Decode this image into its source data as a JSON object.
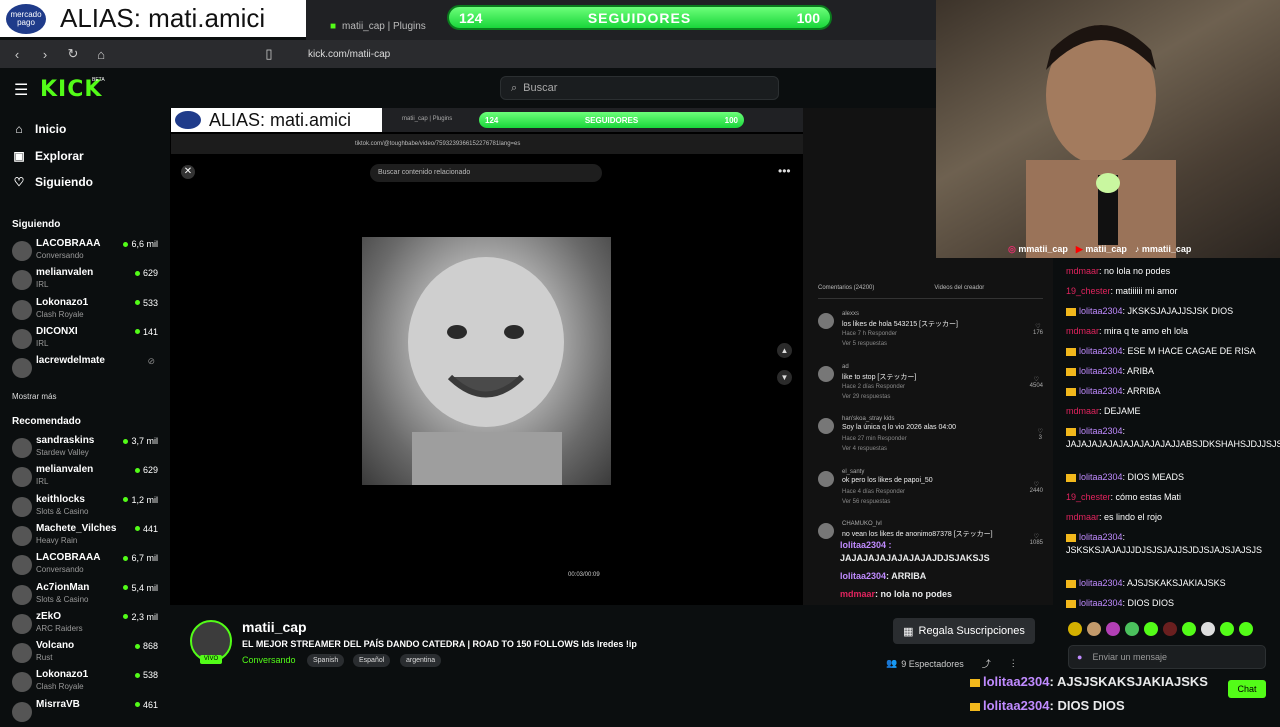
{
  "overlay": {
    "mp_logo": "mercado pago",
    "alias": "ALIAS: mati.amici",
    "followers_current": "124",
    "followers_label": "SEGUIDORES",
    "followers_goal": "100"
  },
  "browser": {
    "tab_title": "matii_cap | Plugins",
    "url": "kick.com/matii-cap"
  },
  "header": {
    "logo": "KICK",
    "beta": "BETA",
    "search_placeholder": "Buscar"
  },
  "sidebar": {
    "nav": [
      {
        "label": "Inicio",
        "icon": "home-icon"
      },
      {
        "label": "Explorar",
        "icon": "compass-icon"
      },
      {
        "label": "Siguiendo",
        "icon": "heart-icon"
      }
    ],
    "following_header": "Siguiendo",
    "following": [
      {
        "name": "LACOBRAAA",
        "category": "Conversando",
        "viewers": "6,6 mil"
      },
      {
        "name": "melianvalen",
        "category": "IRL",
        "viewers": "629"
      },
      {
        "name": "Lokonazo1",
        "category": "Clash Royale",
        "viewers": "533"
      },
      {
        "name": "DICONXI",
        "category": "IRL",
        "viewers": "141"
      },
      {
        "name": "lacrewdelmate",
        "category": "",
        "viewers": ""
      }
    ],
    "show_more": "Mostrar más",
    "recommended_header": "Recomendado",
    "recommended": [
      {
        "name": "sandraskins",
        "category": "Stardew Valley",
        "viewers": "3,7 mil"
      },
      {
        "name": "melianvalen",
        "category": "IRL",
        "viewers": "629"
      },
      {
        "name": "keithlocks",
        "category": "Slots & Casino",
        "viewers": "1,2 mil"
      },
      {
        "name": "Machete_Vilches",
        "category": "Heavy Rain",
        "viewers": "441"
      },
      {
        "name": "LACOBRAAA",
        "category": "Conversando",
        "viewers": "6,7 mil"
      },
      {
        "name": "Ac7ionMan",
        "category": "Slots & Casino",
        "viewers": "5,4 mil"
      },
      {
        "name": "zEkO",
        "category": "ARC Raiders",
        "viewers": "2,3 mil"
      },
      {
        "name": "Volcano",
        "category": "Rust",
        "viewers": "868"
      },
      {
        "name": "Lokonazo1",
        "category": "Clash Royale",
        "viewers": "538"
      },
      {
        "name": "MisrraVB",
        "category": "",
        "viewers": "461"
      }
    ]
  },
  "video": {
    "inner_alias": "ALIAS: mati.amici",
    "inner_followers": [
      "124",
      "SEGUIDORES",
      "100"
    ],
    "inner_tab": "matii_cap | Plugins",
    "inner_url": "tiktok.com/@toughbabe/video/7593239366152276781lang=es",
    "tiktok_search": "Buscar contenido relacionado",
    "time": "00:03/00:09",
    "comments_tab": "Comentarios (24200)",
    "creator_tab": "Videos del creador",
    "comments": [
      {
        "user": "alexxs",
        "text": "los likes de hola 543215 [ステッカー]",
        "meta": "Hace 7 h   Responder",
        "replies": "Ver 5 respuestas",
        "likes": "176"
      },
      {
        "user": "ad",
        "text": "like to stop [ステッカー]",
        "meta": "Hace 2 días   Responder",
        "replies": "Ver 29 respuestas",
        "likes": "4504"
      },
      {
        "user": "han'skoa_stray kids",
        "text": "Soy la única q lo vio 2026 alas 04:00",
        "meta": "Hace 27 min   Responder",
        "replies": "Ver 4 respuestas",
        "likes": "3"
      },
      {
        "user": "el_santy",
        "text": "ok pero los likes de papoi_50",
        "meta": "Hace 4 días   Responder",
        "replies": "Ver 56 respuestas",
        "likes": "2440"
      },
      {
        "user": "CHAMUKO_lvl",
        "text": "no vean los likes de anonimo87378 [ステッカー]",
        "meta": "",
        "replies": "",
        "likes": "1085"
      }
    ],
    "overlay_chat": [
      {
        "user": "lolitaa2304 :",
        "text": ""
      },
      {
        "user": "",
        "text": "JAJAJAJAJAJAJAJAJDJSJAKSJS"
      },
      {
        "user": "lolitaa2304",
        "text": ": ARRIBA"
      },
      {
        "user": "mdmaar",
        "text": ": no lola no podes"
      }
    ]
  },
  "cam": {
    "socials": [
      "mmatii_cap",
      "matii_cap",
      "mmatii_cap"
    ]
  },
  "chat": {
    "messages": [
      {
        "user": "mdmaar",
        "text": ": no lola no podes",
        "color": "#e0245e",
        "badge": false
      },
      {
        "user": "19_chester",
        "text": ": matiiiiii mi amor",
        "color": "#e0245e",
        "badge": false
      },
      {
        "user": "lolitaa2304",
        "text": ": JKSKSJAJAJJSJSK DIOS",
        "color": "#c08bff",
        "badge": true
      },
      {
        "user": "mdmaar",
        "text": ": mira q te amo eh lola",
        "color": "#e0245e",
        "badge": false
      },
      {
        "user": "lolitaa2304",
        "text": ": ESE M HACE CAGAE DE RISA",
        "color": "#c08bff",
        "badge": true
      },
      {
        "user": "lolitaa2304",
        "text": ": ARIBA",
        "color": "#c08bff",
        "badge": true
      },
      {
        "user": "lolitaa2304",
        "text": ": ARRIBA",
        "color": "#c08bff",
        "badge": true
      },
      {
        "user": "mdmaar",
        "text": ": DEJAME",
        "color": "#e0245e",
        "badge": false
      },
      {
        "user": "lolitaa2304",
        "text": ": JAJAJAJAJAJAJAJAJAJAJJABSJDKSHAHSJDJJSJSJD",
        "color": "#c08bff",
        "badge": true
      },
      {
        "user": "lolitaa2304",
        "text": ": DIOS MEADS",
        "color": "#c08bff",
        "badge": true
      },
      {
        "user": "19_chester",
        "text": ": cómo estas Mati",
        "color": "#e0245e",
        "badge": false
      },
      {
        "user": "mdmaar",
        "text": ": es lindo el rojo",
        "color": "#e0245e",
        "badge": false
      },
      {
        "user": "lolitaa2304",
        "text": ": JSKSKSJAJAJJJDJSJSJAJJSJDJSJAJSJAJSJS",
        "color": "#c08bff",
        "badge": true
      },
      {
        "user": "lolitaa2304",
        "text": ": AJSJSKAKSJAKIAJSKS",
        "color": "#c08bff",
        "badge": true
      },
      {
        "user": "lolitaa2304",
        "text": ": DIOS DIOS",
        "color": "#c08bff",
        "badge": true
      }
    ],
    "input_placeholder": "Enviar un mensaje",
    "send_label": "Chat",
    "overlay_bottom": [
      {
        "user": "lolitaa2304",
        "text": ": AJSJSKAKSJAKIAJSKS"
      },
      {
        "user": "lolitaa2304",
        "text": ": DIOS DIOS"
      }
    ]
  },
  "stream": {
    "name": "matii_cap",
    "title": "EL MEJOR STREAMER DEL PAÍS DANDO CATEDRA | ROAD TO 150 FOLLOWS lds lredes !ip",
    "category": "Conversando",
    "tags": [
      "Spanish",
      "Español",
      "argentina"
    ],
    "live": "VIVO",
    "subscribe": "Regala Suscripciones",
    "viewers": "9 Espectadores"
  }
}
